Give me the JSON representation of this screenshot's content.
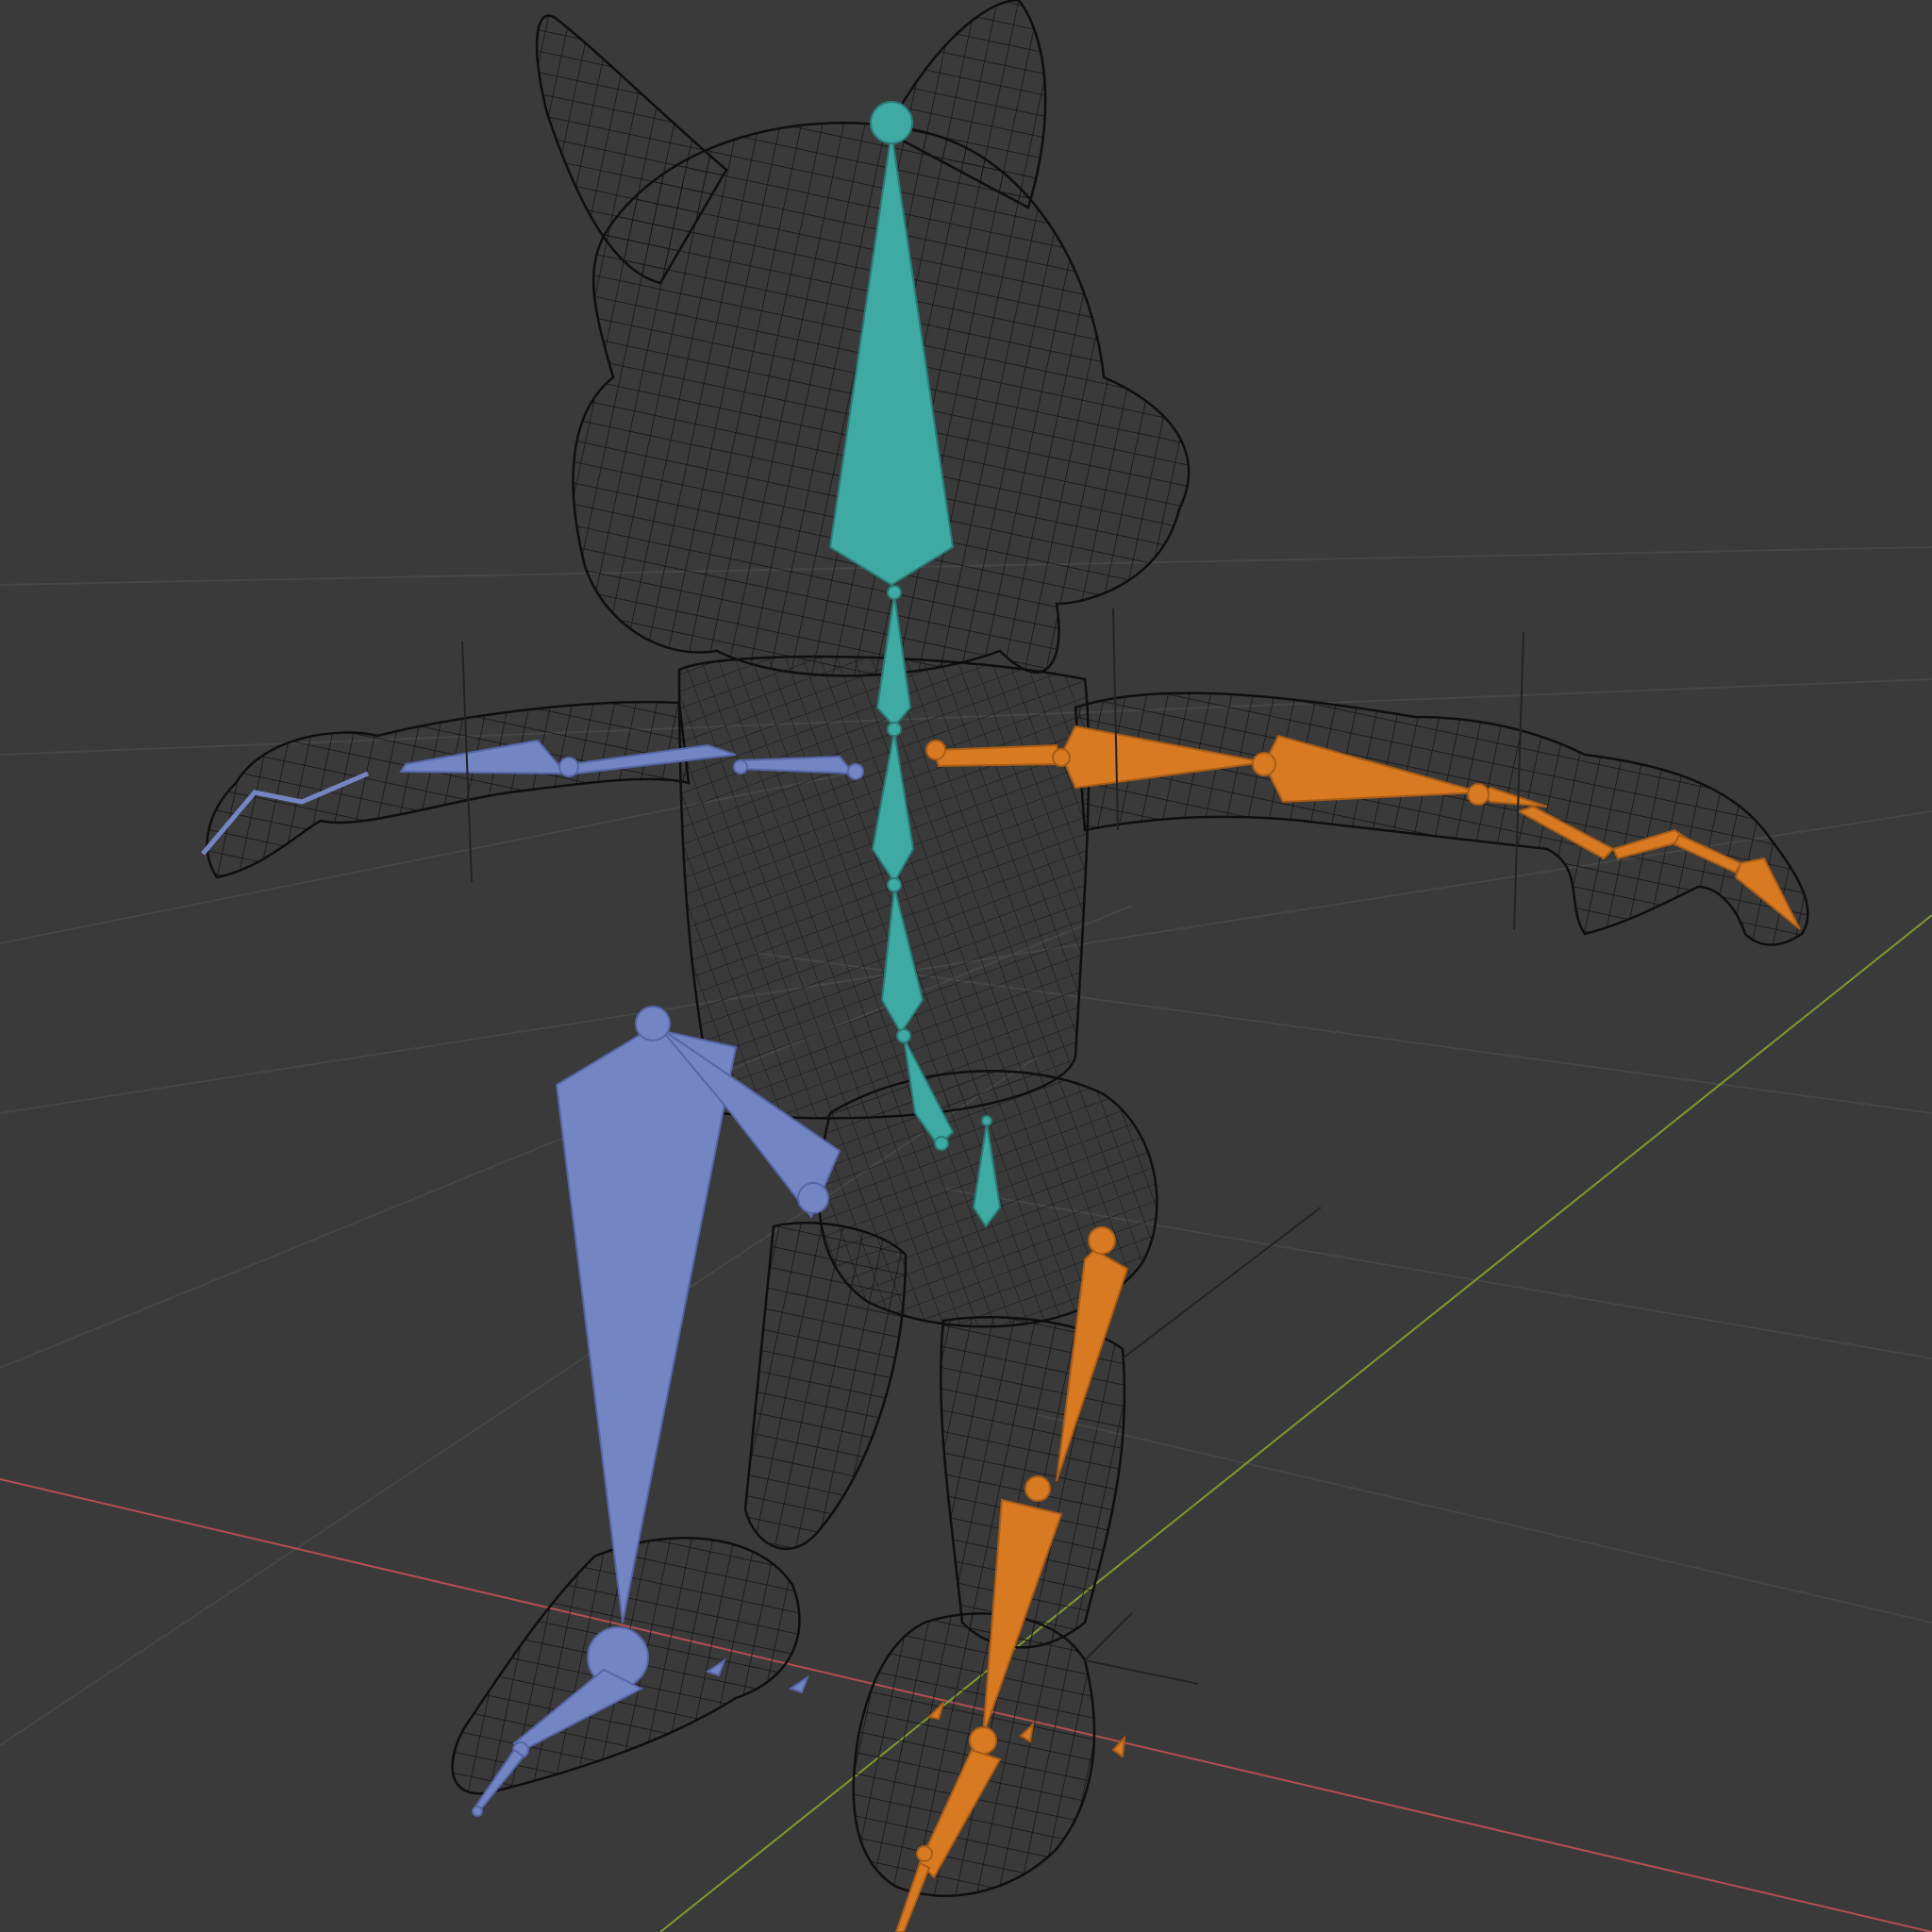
{
  "viewport": {
    "background": "#3a3a3a",
    "grid_color": "#454545",
    "x_axis_color": "#b54f4f",
    "y_axis_color": "#7f9a2e"
  },
  "mesh": {
    "wire_color": "#111111",
    "fill_color": "#2e2e2e"
  },
  "armature": {
    "center_color": "#3fa9a3",
    "left_color": "#7485c4",
    "right_color": "#d87a22"
  }
}
